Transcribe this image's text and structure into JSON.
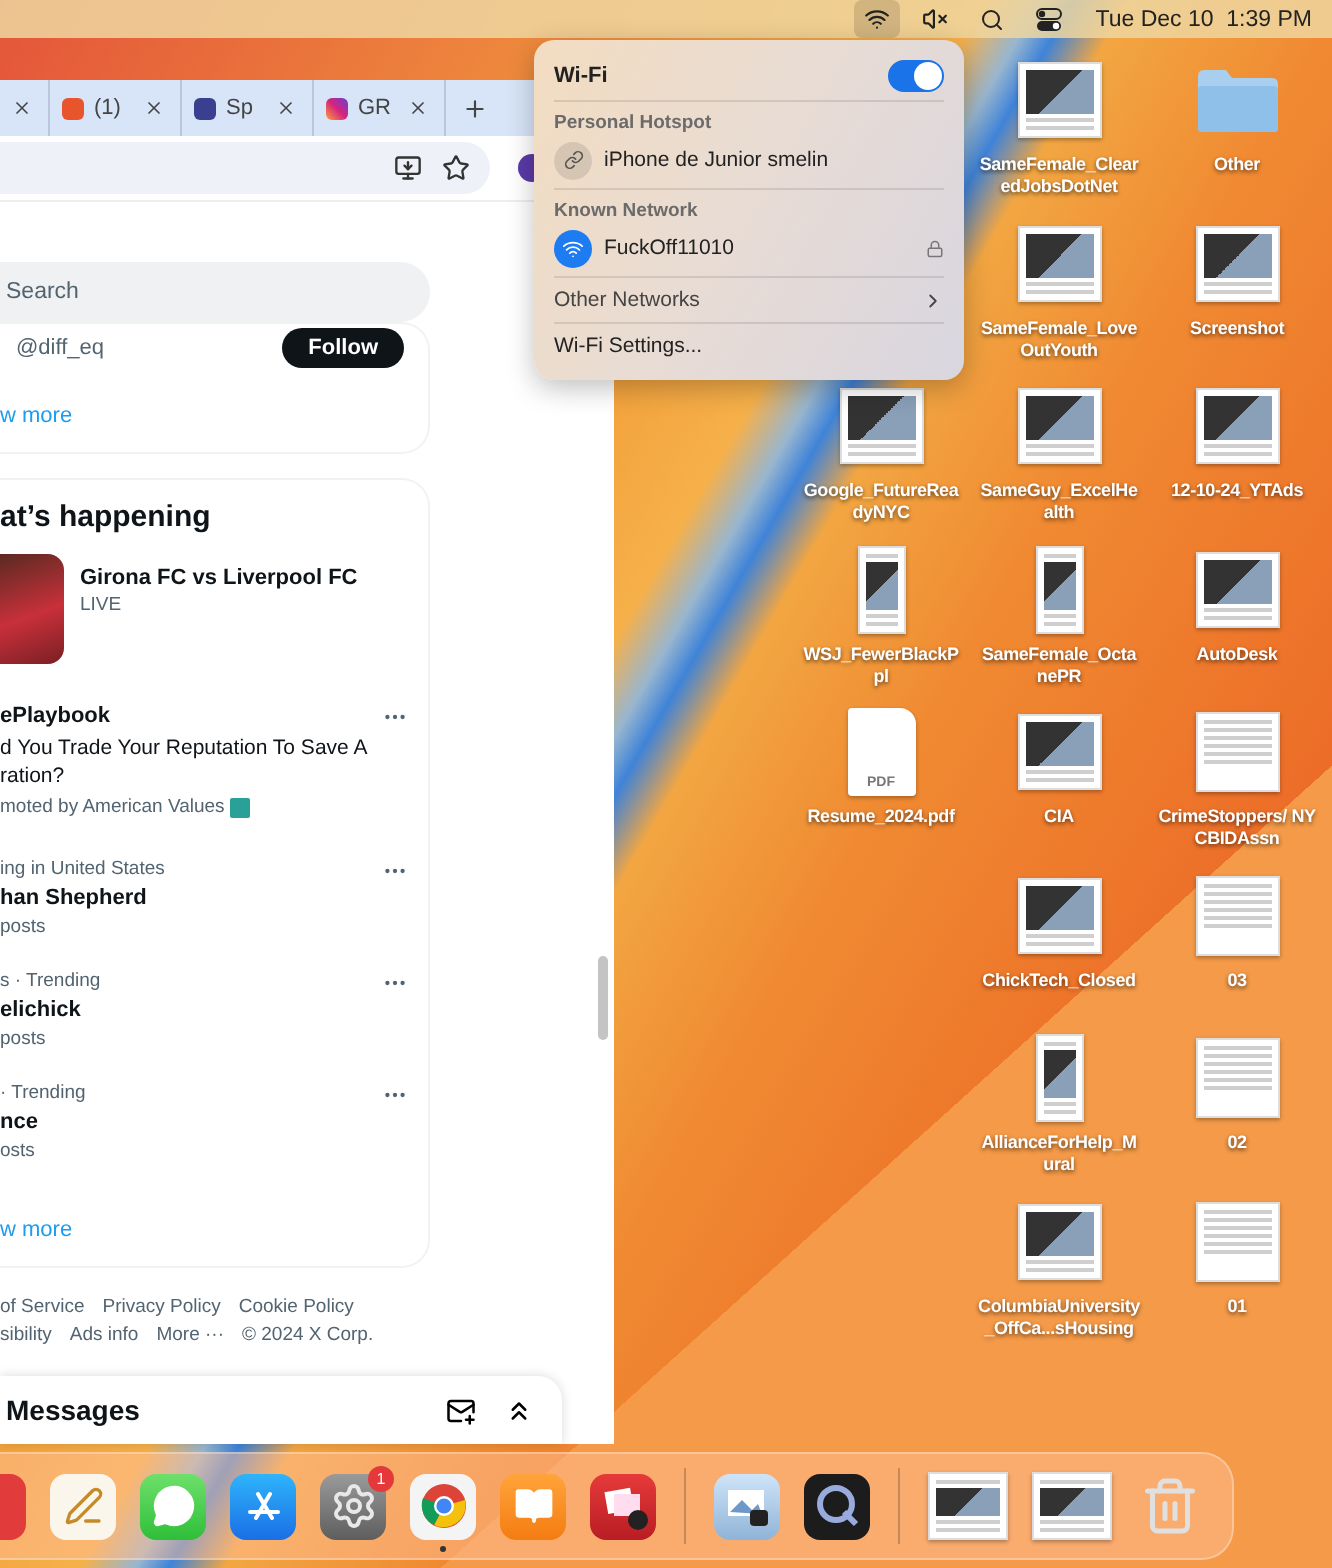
{
  "menu_bar": {
    "status_icons": [
      {
        "kind": "wifi",
        "selected": true
      },
      {
        "kind": "muted",
        "selected": false
      },
      {
        "kind": "search",
        "selected": false
      },
      {
        "kind": "control_center",
        "selected": false
      }
    ],
    "clock": "Tue Dec 10  1:39 PM"
  },
  "browser": {
    "tabs": [
      {
        "kind": "blank"
      },
      {
        "kind": "bookmark",
        "title": "(1)"
      },
      {
        "kind": "people",
        "title": "Sp"
      },
      {
        "kind": "camera",
        "title": "GR"
      }
    ]
  },
  "twitter": {
    "search": {
      "placeholder": "Search"
    },
    "who_to_follow": {
      "handle": "@diff_eq",
      "button": "Follow",
      "show_more": "w more"
    },
    "whats_happening": {
      "title": "at’s happening",
      "event": {
        "title": "Girona FC vs Liverpool FC",
        "status": "LIVE"
      },
      "trends": [
        {
          "kind": "promoted",
          "name": "ePlaybook",
          "description": "d You Trade Your Reputation To Save A ration?",
          "meta": "moted by American Values"
        },
        {
          "kind": "trend",
          "context": "ing in United States",
          "name": "han Shepherd",
          "count": "posts"
        },
        {
          "kind": "trend",
          "context": "s · Trending",
          "name": "elichick",
          "count": "posts"
        },
        {
          "kind": "trend",
          "context": "· Trending",
          "name": "nce",
          "count": "osts"
        }
      ],
      "show_more": "w more"
    },
    "footer_lines": [
      [
        "of Service",
        "Privacy Policy",
        "Cookie Policy"
      ],
      [
        "sibility",
        "Ads info",
        "More ···",
        "© 2024 X Corp."
      ]
    ],
    "messages": {
      "title": "Messages"
    }
  },
  "wifi_menu": {
    "title": "Wi-Fi",
    "on": true,
    "sections": [
      {
        "heading": "Personal Hotspot",
        "networks": [
          {
            "kind": "hotspot",
            "name": "iPhone de Junior smelin",
            "locked": false
          }
        ]
      },
      {
        "heading": "Known Network",
        "networks": [
          {
            "kind": "wifi",
            "name": "FuckOff11010",
            "locked": true
          }
        ]
      }
    ],
    "other_networks": "Other Networks",
    "settings": "Wi-Fi Settings..."
  },
  "desktop_icons": [
    {
      "kind": "screenshot",
      "label": "SameFemale_ClearedJobsDotNet"
    },
    {
      "kind": "folder",
      "label": "Other"
    },
    {
      "kind": "screenshot",
      "label": "SameFemale_LoveOutYouth"
    },
    {
      "kind": "screenshot",
      "label": "Screenshot"
    },
    {
      "kind": "screenshot",
      "label": "Google_FutureReadyNYC"
    },
    {
      "kind": "screenshot",
      "label": "SameGuy_ExcelHealth"
    },
    {
      "kind": "screenshot",
      "label": "12-10-24_YTAds"
    },
    {
      "kind": "portrait",
      "label": "WSJ_FewerBlackPpl"
    },
    {
      "kind": "portrait",
      "label": "SameFemale_OctanePR"
    },
    {
      "kind": "screenshot",
      "label": "AutoDesk"
    },
    {
      "kind": "pdf",
      "label": "Resume_2024.pdf",
      "tag": "PDF"
    },
    {
      "kind": "screenshot",
      "label": "CIA"
    },
    {
      "kind": "document",
      "label": "CrimeStoppers/ NYCBIDAssn"
    },
    {
      "kind": "screenshot",
      "label": "ChickTech_Closed"
    },
    {
      "kind": "document",
      "label": "03"
    },
    {
      "kind": "portrait",
      "label": "AllianceForHelp_Mural"
    },
    {
      "kind": "document",
      "label": "02"
    },
    {
      "kind": "screenshot",
      "label": "ColumbiaUniversity_OffCa...sHousing"
    },
    {
      "kind": "document",
      "label": "01"
    }
  ],
  "dock": {
    "sections": [
      {
        "apps": [
          {
            "kind": "red",
            "running": false
          },
          {
            "kind": "pen",
            "running": false
          },
          {
            "kind": "chat",
            "running": false
          },
          {
            "kind": "store",
            "running": false
          },
          {
            "kind": "gear",
            "running": false,
            "badge": "1"
          },
          {
            "kind": "browser",
            "running": true
          },
          {
            "kind": "book",
            "running": false
          },
          {
            "kind": "photos",
            "running": false
          }
        ]
      },
      {
        "apps": [
          {
            "kind": "preview",
            "running": false
          },
          {
            "kind": "player",
            "running": false
          }
        ]
      },
      {
        "apps": [
          {
            "kind": "window",
            "running": false
          },
          {
            "kind": "window",
            "running": false
          },
          {
            "kind": "trash",
            "running": false
          }
        ]
      }
    ]
  }
}
